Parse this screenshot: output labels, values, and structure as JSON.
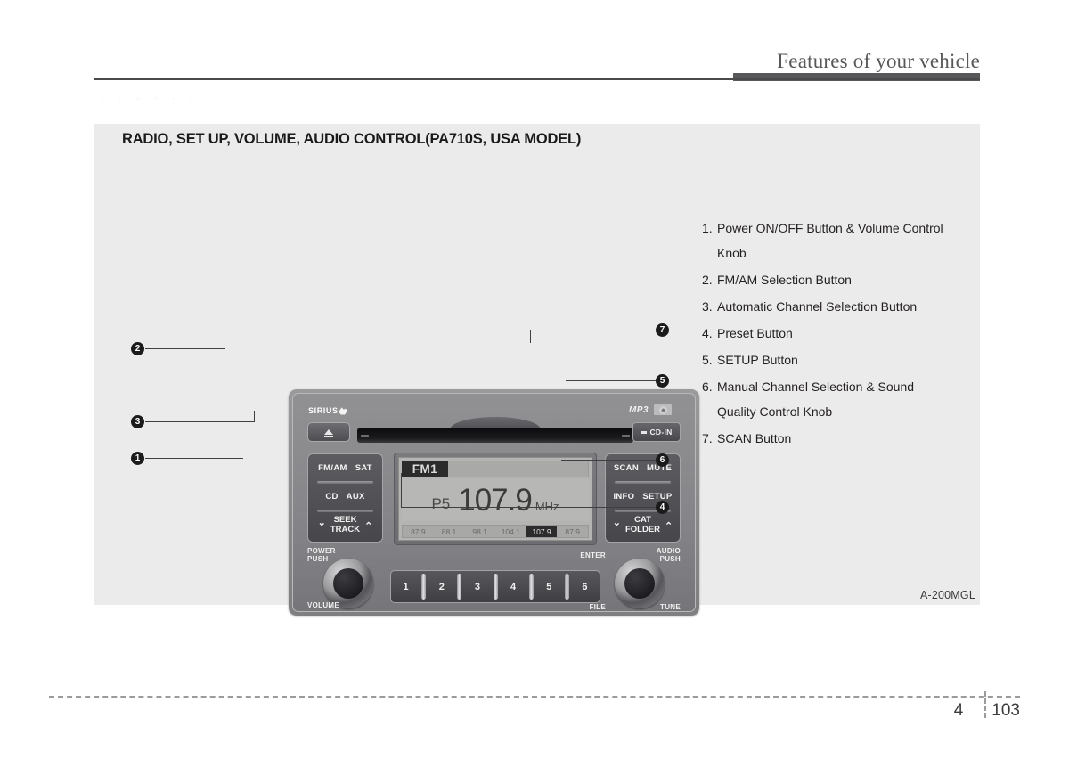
{
  "header": {
    "title": "Features of your vehicle",
    "watermark": "• • • • • •"
  },
  "section": {
    "title": "RADIO, SET UP, VOLUME, AUDIO CONTROL(PA710S, USA MODEL)",
    "figure_code": "A-200MGL"
  },
  "descriptions": [
    {
      "num": "1.",
      "text": "Power ON/OFF Button & Volume Control",
      "cont": "Knob"
    },
    {
      "num": "2.",
      "text": "FM/AM Selection Button",
      "cont": ""
    },
    {
      "num": "3.",
      "text": "Automatic Channel Selection Button",
      "cont": ""
    },
    {
      "num": "4.",
      "text": "Preset Button",
      "cont": ""
    },
    {
      "num": "5.",
      "text": "SETUP Button",
      "cont": ""
    },
    {
      "num": "6.",
      "text": "Manual Channel Selection & Sound",
      "cont": "Quality Control Knob"
    },
    {
      "num": "7.",
      "text": "SCAN Button",
      "cont": ""
    }
  ],
  "radio": {
    "brand_sirius": "SIRIUS",
    "brand_mp3": "MP3",
    "cd_in_label": "CD-IN",
    "left_keys": {
      "row1": [
        "FM/AM",
        "SAT"
      ],
      "row2": [
        "CD",
        "AUX"
      ],
      "row3": [
        "SEEK",
        "TRACK"
      ],
      "chev_down": "⌄",
      "chev_up": "⌃"
    },
    "right_keys": {
      "row1": [
        "SCAN",
        "MUTE"
      ],
      "row2": [
        "INFO",
        "SETUP"
      ],
      "row3": [
        "CAT",
        "FOLDER"
      ]
    },
    "knob_labels": {
      "power": "POWER",
      "power_sub": "PUSH",
      "volume": "VOLUME",
      "enter": "ENTER",
      "audio": "AUDIO",
      "audio_sub": "PUSH",
      "file": "FILE",
      "tune": "TUNE"
    },
    "preset_keys": [
      "1",
      "2",
      "3",
      "4",
      "5",
      "6"
    ],
    "display": {
      "band": "FM1",
      "preset": "P5",
      "frequency": "107.9",
      "unit": "MHz",
      "preset_row": [
        "87.9",
        "88.1",
        "98.1",
        "104.1",
        "107.9",
        "87.9"
      ],
      "active_preset_index": 4
    }
  },
  "callouts": [
    {
      "id": "1",
      "glyph": "1"
    },
    {
      "id": "2",
      "glyph": "2"
    },
    {
      "id": "3",
      "glyph": "3"
    },
    {
      "id": "4",
      "glyph": "4"
    },
    {
      "id": "5",
      "glyph": "5"
    },
    {
      "id": "6",
      "glyph": "6"
    },
    {
      "id": "7",
      "glyph": "7"
    }
  ],
  "footer": {
    "chapter": "4",
    "page": "103"
  },
  "colors": {
    "panel_bg": "#ebebeb",
    "header_rule": "#58585a",
    "text": "#231f20",
    "screen_bg": "#b4b4b2",
    "screen_dark": "#2b2b2b"
  }
}
